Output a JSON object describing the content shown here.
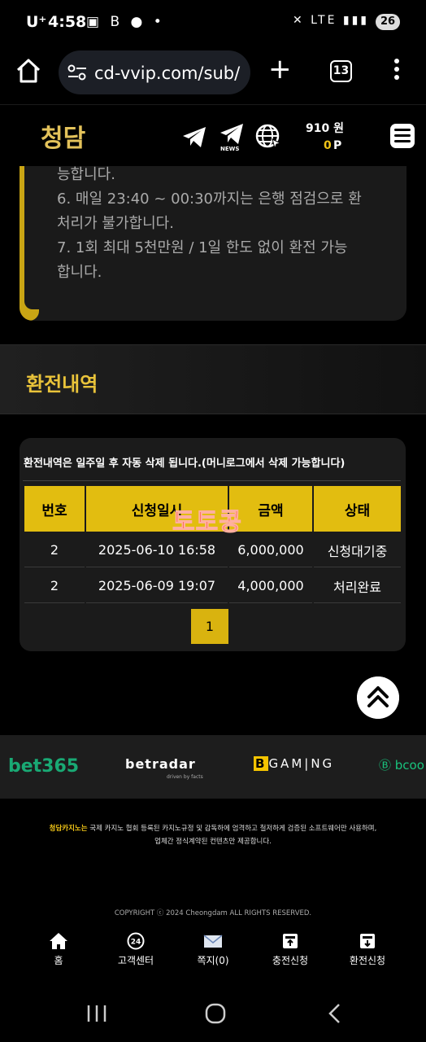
{
  "status_bar": {
    "carrier": "U⁺",
    "time": "4:58",
    "network": "LTE",
    "battery": "26"
  },
  "browser": {
    "url": "cd-vvip.com/sub/",
    "tab_count": "13"
  },
  "header": {
    "logo": "청담",
    "news_label": "NEWS",
    "money_amount": "910",
    "money_unit": "원",
    "points_value": "0",
    "points_unit": "P"
  },
  "notice": {
    "lines": [
      "능합니다.",
      "6. 매일 23:40 ~ 00:30까지는 은행 점검으로 환",
      "처리가 불가합니다.",
      "7. 1회 최대 5천만원 / 1일 한도 없이 환전 가능",
      "합니다."
    ]
  },
  "section": {
    "title": "환전내역"
  },
  "history": {
    "note": "환전내역은 일주일 후 자동 삭제 됩니다.(머니로그에서 삭제 가능합니다)",
    "columns": [
      "번호",
      "신청일시",
      "금액",
      "상태"
    ],
    "rows": [
      [
        "2",
        "2025-06-10 16:58",
        "6,000,000",
        "신청대기중"
      ],
      [
        "2",
        "2025-06-09 19:07",
        "4,000,000",
        "처리완료"
      ]
    ],
    "page": "1",
    "watermark": "토토콩"
  },
  "partners": {
    "bet365": "bet365",
    "betradar": "betradar",
    "betradar_sub": "driven by facts",
    "bgaming_mark": "B",
    "bgaming": "GAM|NG",
    "bcoom": "bcoo"
  },
  "footer": {
    "brand": "청담카지노는",
    "line1": " 국제 카지노 협회 등록된 카지노규정 및 감독하에 엄격하고 철저하게 검증된 소프트웨어만 사용하며,",
    "line2": "업체간 정식계약된 컨텐츠만 제공합니다.",
    "copyright": "COPYRIGHT ⓒ 2024 Cheongdam ALL RIGHTS RESERVED."
  },
  "bottom_nav": [
    {
      "label": "홈",
      "icon": "home-icon"
    },
    {
      "label": "고객센터",
      "icon": "support-24-icon"
    },
    {
      "label": "쪽지(0)",
      "icon": "mail-icon"
    },
    {
      "label": "충전신청",
      "icon": "deposit-icon"
    },
    {
      "label": "환전신청",
      "icon": "withdraw-icon"
    }
  ],
  "colors": {
    "gold": "#e2bd10",
    "title_gold": "#e9c33a",
    "watermark_red": "#ff2a1a"
  }
}
